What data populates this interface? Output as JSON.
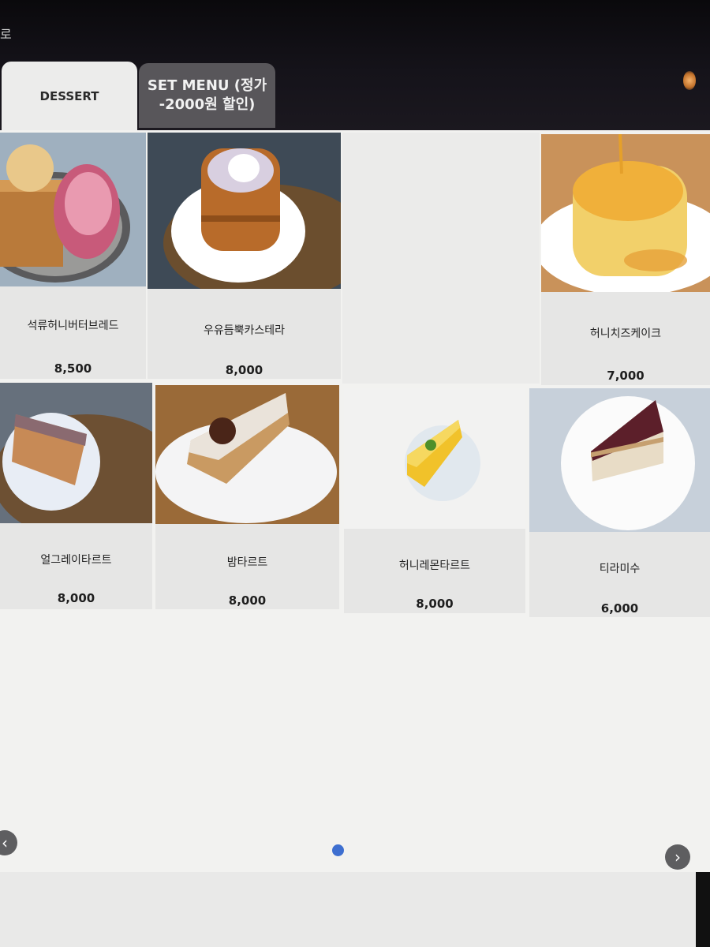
{
  "header": {
    "back_label": "로"
  },
  "tabs": [
    {
      "label": "DESSERT",
      "active": true
    },
    {
      "label": "SET MENU (정가\n-2000원 할인)",
      "active": false
    }
  ],
  "menu": {
    "items": [
      {
        "name": "석류허니버터브레드",
        "price": "8,500"
      },
      {
        "name": "우유듬뿍카스테라",
        "price": "8,000"
      },
      {
        "name": "허니치즈케이크",
        "price": "7,000"
      },
      {
        "name": "얼그레이타르트",
        "price": "8,000"
      },
      {
        "name": "밤타르트",
        "price": "8,000"
      },
      {
        "name": "허니레몬타르트",
        "price": "8,000"
      },
      {
        "name": "티라미수",
        "price": "6,000"
      }
    ]
  },
  "pager": {
    "active_color": "#3e6fd0"
  },
  "icons": {
    "prev": "chevron-left-icon",
    "next": "chevron-right-icon"
  }
}
